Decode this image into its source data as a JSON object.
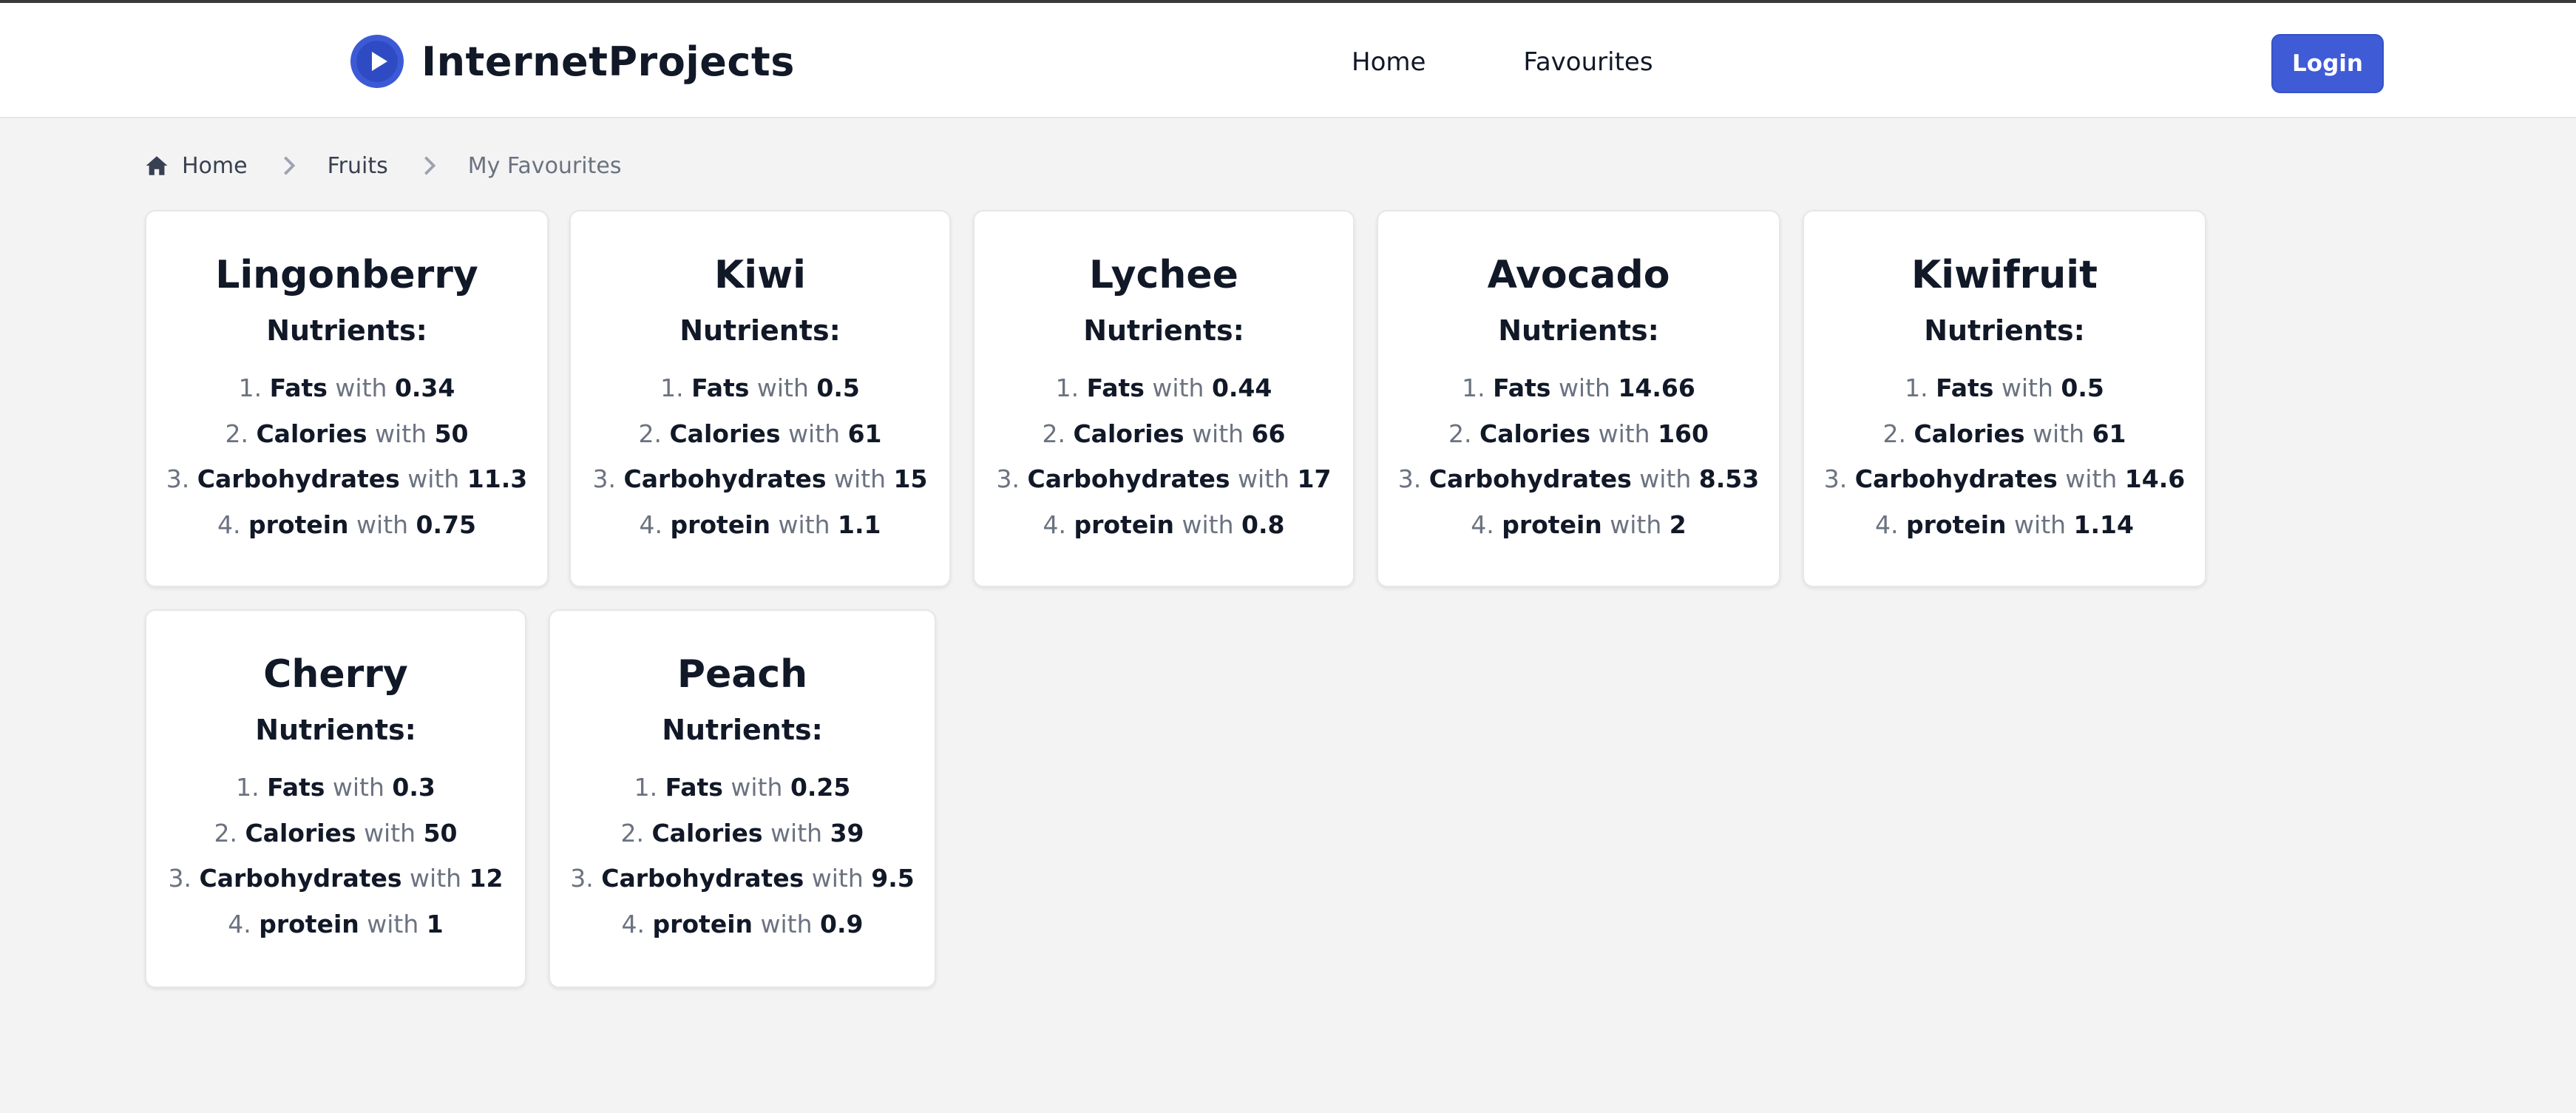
{
  "header": {
    "brand": "InternetProjects",
    "nav": [
      "Home",
      "Favourites"
    ],
    "login_label": "Login"
  },
  "breadcrumb": {
    "home": "Home",
    "section": "Fruits",
    "current": "My Favourites"
  },
  "labels": {
    "nutrients": "Nutrients:",
    "with": "with"
  },
  "colors": {
    "accent": "#3f5bd6",
    "background": "#f3f3f3"
  },
  "fruits": [
    {
      "name": "Lingonberry",
      "nutrients": [
        [
          "Fats",
          "0.34"
        ],
        [
          "Calories",
          "50"
        ],
        [
          "Carbohydrates",
          "11.3"
        ],
        [
          "protein",
          "0.75"
        ]
      ]
    },
    {
      "name": "Kiwi",
      "nutrients": [
        [
          "Fats",
          "0.5"
        ],
        [
          "Calories",
          "61"
        ],
        [
          "Carbohydrates",
          "15"
        ],
        [
          "protein",
          "1.1"
        ]
      ]
    },
    {
      "name": "Lychee",
      "nutrients": [
        [
          "Fats",
          "0.44"
        ],
        [
          "Calories",
          "66"
        ],
        [
          "Carbohydrates",
          "17"
        ],
        [
          "protein",
          "0.8"
        ]
      ]
    },
    {
      "name": "Avocado",
      "nutrients": [
        [
          "Fats",
          "14.66"
        ],
        [
          "Calories",
          "160"
        ],
        [
          "Carbohydrates",
          "8.53"
        ],
        [
          "protein",
          "2"
        ]
      ]
    },
    {
      "name": "Kiwifruit",
      "nutrients": [
        [
          "Fats",
          "0.5"
        ],
        [
          "Calories",
          "61"
        ],
        [
          "Carbohydrates",
          "14.6"
        ],
        [
          "protein",
          "1.14"
        ]
      ]
    },
    {
      "name": "Cherry",
      "nutrients": [
        [
          "Fats",
          "0.3"
        ],
        [
          "Calories",
          "50"
        ],
        [
          "Carbohydrates",
          "12"
        ],
        [
          "protein",
          "1"
        ]
      ]
    },
    {
      "name": "Peach",
      "nutrients": [
        [
          "Fats",
          "0.25"
        ],
        [
          "Calories",
          "39"
        ],
        [
          "Carbohydrates",
          "9.5"
        ],
        [
          "protein",
          "0.9"
        ]
      ]
    }
  ]
}
